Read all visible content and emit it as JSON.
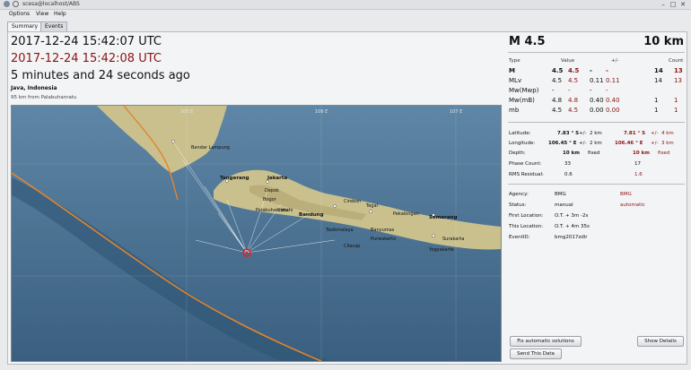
{
  "window": {
    "title": "scesa@localhost/ABS",
    "min": "–",
    "max": "□",
    "close": "✕"
  },
  "menu": {
    "options": "Options",
    "view": "View",
    "help": "Help"
  },
  "tabs": {
    "summary": "Summary",
    "events": "Events"
  },
  "event": {
    "origin_time": "2017-12-24 15:42:07 UTC",
    "auto_time": "2017-12-24 15:42:08 UTC",
    "age": "5 minutes and 24 seconds ago",
    "region": "Java, Indonesia",
    "nearest": "95 km from Palabuhanratu"
  },
  "map": {
    "lon_labels": [
      "105 E",
      "106 E",
      "107 E"
    ],
    "cities": [
      "Bandar Lampung",
      "Tangerang",
      "Jakarta",
      "Depok",
      "Bogor",
      "Cimahi",
      "Bandung",
      "Cirebon",
      "Tegal",
      "Pekalongan",
      "Semarang",
      "Tasikmalaya",
      "Banyumas",
      "Purwokerto",
      "Cilacap",
      "Surakarta",
      "Yogyakarta",
      "Palabuhanratu"
    ]
  },
  "summary": {
    "magnitude": "M 4.5",
    "depth": "10 km",
    "headers": {
      "type": "Type",
      "value": "Value",
      "pm": "+/-",
      "count": "Count"
    },
    "magnitudes": [
      {
        "type": "M",
        "v1": "4.5",
        "v2": "4.5",
        "e1": "-",
        "e2": "-",
        "c1": "14",
        "c2": "13"
      },
      {
        "type": "MLv",
        "v1": "4.5",
        "v2": "4.5",
        "e1": "0.11",
        "e2": "0.11",
        "c1": "14",
        "c2": "13"
      },
      {
        "type": "Mw(Mwp)",
        "v1": "-",
        "v2": "-",
        "e1": "-",
        "e2": "-",
        "c1": "",
        "c2": ""
      },
      {
        "type": "Mw(mB)",
        "v1": "4.8",
        "v2": "4.8",
        "e1": "0.40",
        "e2": "0.40",
        "c1": "1",
        "c2": "1"
      },
      {
        "type": "mb",
        "v1": "4.5",
        "v2": "4.5",
        "e1": "0.00",
        "e2": "0.00",
        "c1": "1",
        "c2": "1"
      }
    ],
    "location": {
      "lat_label": "Latitude:",
      "lat_v1": "7.83 ° S",
      "lat_pm1": "+/-",
      "lat_e1": "2 km",
      "lat_v2": "7.81 ° S",
      "lat_pm2": "+/-",
      "lat_e2": "4 km",
      "lon_label": "Longitude:",
      "lon_v1": "106.45 ° E",
      "lon_pm1": "+/-",
      "lon_e1": "2 km",
      "lon_v2": "106.46 ° E",
      "lon_pm2": "+/-",
      "lon_e2": "3 km",
      "dep_label": "Depth:",
      "dep_v1": "10 km",
      "dep_f1": "fixed",
      "dep_v2": "10 km",
      "dep_f2": "fixed",
      "phase_label": "Phase Count:",
      "phase_v1": "33",
      "phase_v2": "17",
      "rms_label": "RMS Residual:",
      "rms_v1": "0.6",
      "rms_v2": "1.6"
    },
    "agency": {
      "agency_label": "Agency:",
      "agency_v1": "BMG",
      "agency_v2": "BMG",
      "status_label": "Status:",
      "status_v1": "manual",
      "status_v2": "automatic",
      "first_label": "First Location:",
      "first_v": "O.T. + 3m -2s",
      "this_label": "This Location:",
      "this_v": "O.T. + 4m 35s",
      "id_label": "EventID:",
      "id_v": "bmg2017zdlr"
    },
    "buttons": {
      "fix": "Fix automatic solutions",
      "show": "Show Details",
      "send": "Send This Data"
    }
  },
  "colors": {
    "auto_red": "#8b1414",
    "sea": "#466d8f",
    "land": "#c9c08e"
  }
}
